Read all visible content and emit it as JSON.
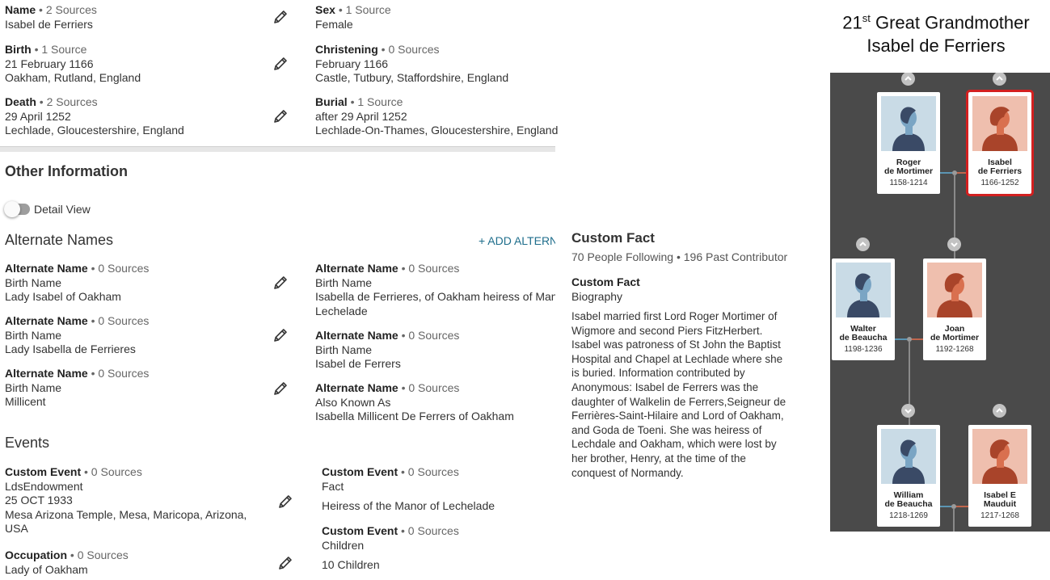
{
  "vitals": {
    "name": {
      "label": "Name",
      "sources": "• 2 Sources",
      "lines": [
        "Isabel de Ferriers"
      ]
    },
    "sex": {
      "label": "Sex",
      "sources": "• 1 Source",
      "lines": [
        "Female"
      ]
    },
    "birth": {
      "label": "Birth",
      "sources": "• 1 Source",
      "lines": [
        "21 February 1166",
        "Oakham, Rutland, England"
      ]
    },
    "christening": {
      "label": "Christening",
      "sources": "• 0 Sources",
      "lines": [
        "February 1166",
        "Castle, Tutbury, Staffordshire, England"
      ]
    },
    "death": {
      "label": "Death",
      "sources": "• 2 Sources",
      "lines": [
        "29 April 1252",
        "Lechlade, Gloucestershire, England"
      ]
    },
    "burial": {
      "label": "Burial",
      "sources": "• 1 Source",
      "lines": [
        "after 29 April 1252",
        "Lechlade-On-Thames, Gloucestershire, England"
      ]
    }
  },
  "other_info": {
    "title": "Other Information",
    "detail_view_label": "Detail View"
  },
  "alternate_names": {
    "title": "Alternate Names",
    "add_link": "+ ADD ALTERN",
    "items": [
      {
        "label": "Alternate Name",
        "sources": "• 0 Sources",
        "type": "Birth Name",
        "value": "Lady Isabel of Oakham"
      },
      {
        "label": "Alternate Name",
        "sources": "• 0 Sources",
        "type": "Birth Name",
        "value": "Isabella de Ferrieres, of Oakham heiress of Manor of Lechelade"
      },
      {
        "label": "Alternate Name",
        "sources": "• 0 Sources",
        "type": "Birth Name",
        "value": "Lady Isabella de Ferrieres"
      },
      {
        "label": "Alternate Name",
        "sources": "• 0 Sources",
        "type": "Birth Name",
        "value": "Isabel de Ferrers"
      },
      {
        "label": "Alternate Name",
        "sources": "• 0 Sources",
        "type": "Birth Name",
        "value": "Millicent"
      },
      {
        "label": "Alternate Name",
        "sources": "• 0 Sources",
        "type": "Also Known As",
        "value": "Isabella Millicent De Ferrers of Oakham"
      }
    ]
  },
  "events": {
    "title": "Events",
    "items": [
      {
        "label": "Custom Event",
        "sources": "• 0 Sources",
        "lines": [
          "LdsEndowment",
          "25 OCT 1933",
          "Mesa Arizona Temple, Mesa, Maricopa, Arizona, USA"
        ]
      },
      {
        "label": "Custom Event",
        "sources": "• 0 Sources",
        "type": "Fact",
        "value": "Heiress of the Manor of Lechelade"
      },
      {
        "label": "Occupation",
        "sources": "• 0 Sources",
        "lines": [
          "Lady of Oakham"
        ]
      },
      {
        "label": "Custom Event",
        "sources": "• 0 Sources",
        "type": "Children",
        "value": "10 Children"
      }
    ]
  },
  "custom_fact": {
    "title": "Custom Fact",
    "meta": "70 People Following • 196 Past Contributor",
    "label": "Custom Fact",
    "type": "Biography",
    "bio": "Isabel married first Lord Roger Mortimer of Wigmore and second Piers FitzHerbert. Isabel was patroness of St John the Baptist Hospital and Chapel at Lechlade where she is buried. Information contributed by Anonymous: Isabel de Ferrers was the daughter of Walkelin de Ferrers,Seigneur de Ferrières-Saint-Hilaire and Lord of Oakham, and Goda de Toeni. She was heiress of Lechdale and Oakham, which were lost by her brother, Henry, at the time of the conquest of Normandy."
  },
  "tree": {
    "heading_number": "21",
    "heading_suffix": "st",
    "heading_rest": " Great Grandmother",
    "heading_name": "Isabel de Ferriers",
    "people": [
      {
        "first": "Roger",
        "last": "de Mortimer",
        "years": "1158-1214",
        "sex": "male",
        "selected": false
      },
      {
        "first": "Isabel",
        "last": "de Ferriers",
        "years": "1166-1252",
        "sex": "female",
        "selected": true
      },
      {
        "first": "Walter",
        "last": "de Beaucha",
        "years": "1198-1236",
        "sex": "male",
        "selected": false
      },
      {
        "first": "Joan",
        "last": "de Mortimer",
        "years": "1192-1268",
        "sex": "female",
        "selected": false
      },
      {
        "first": "William",
        "last": "de Beaucha",
        "years": "1218-1269",
        "sex": "male",
        "selected": false
      },
      {
        "first": "Isabel E",
        "last": "Mauduit",
        "years": "1217-1268",
        "sex": "female",
        "selected": false
      }
    ],
    "colors": {
      "background": "#4a4a4a",
      "male_bg": "#c9dbe6",
      "female_bg": "#efbfae",
      "male_figure": "#3a4a66",
      "female_figure": "#a9442a",
      "selected_outline": "#d32020"
    }
  }
}
